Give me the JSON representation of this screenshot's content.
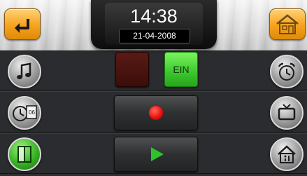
{
  "header": {
    "time": "14:38",
    "date": "21-04-2008"
  },
  "switch": {
    "off_label": "",
    "on_label": "EIN"
  },
  "icons": {
    "back": "back-arrow-icon",
    "home": "home-icon",
    "music": "music-note-icon",
    "alarm": "alarm-clock-icon",
    "timer_calendar": "clock-calendar-icon",
    "calendar_day": "06",
    "tv": "tv-icon",
    "door": "door-icon",
    "house_info": "house-info-icon"
  },
  "colors": {
    "accent_orange": "#f6a21c",
    "on_green": "#39c72b",
    "off_red": "#3a0e0a",
    "record_red": "#e11111",
    "play_green": "#2bc42b"
  }
}
